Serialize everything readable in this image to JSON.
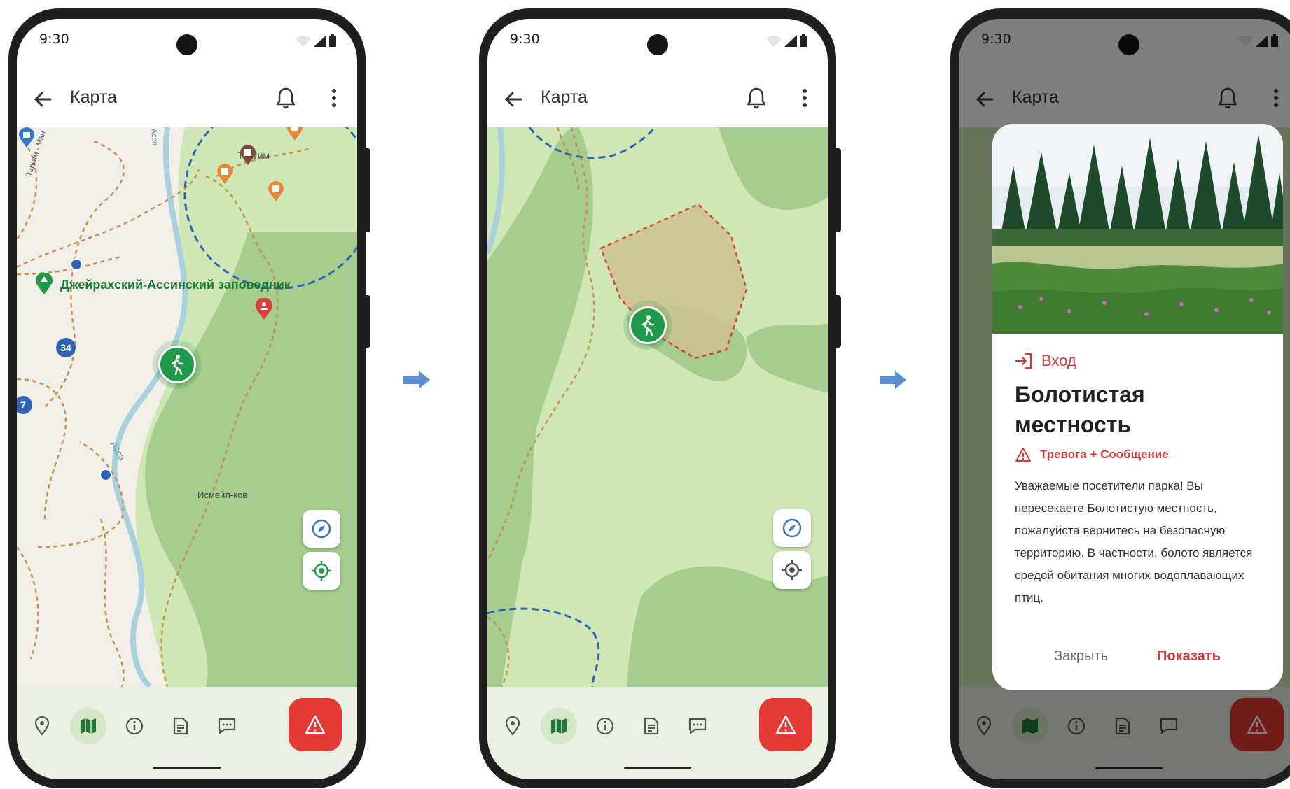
{
  "status": {
    "time": "9:30"
  },
  "appbar": {
    "title": "Карта"
  },
  "map1": {
    "reserve_label": "Джейрахский-Ассинский заповедник",
    "labels": {
      "village": "Исмейл-ков",
      "river": "Асса",
      "road_top": "Ассa",
      "place_top": "Таргим",
      "road_left": "Таргим - Ман"
    },
    "badges": [
      "34",
      "7"
    ]
  },
  "colors": {
    "accent_green": "#1f9a4a",
    "alert_red": "#d33b3b",
    "sos_red": "#e53935",
    "forest": "#a6cc8e",
    "meadow": "#cfe7b4",
    "zone_fill": "#cdbf8f"
  },
  "dialog": {
    "tag": "Вход",
    "title": "Болотистая местность",
    "type": "Тревога + Сообщение",
    "body": "Уважаемые посетители парка! Вы пересекаете Болотистую местность, пожалуйста вернитесь на безопасную территорию.  В частности, болото является средой обитания многих водоплавающих птиц.",
    "close_label": "Закрыть",
    "show_label": "Показать"
  },
  "navbar": {
    "items": [
      "location-icon",
      "map-icon",
      "info-icon",
      "document-icon",
      "chat-icon"
    ],
    "sos": "warning-icon"
  }
}
